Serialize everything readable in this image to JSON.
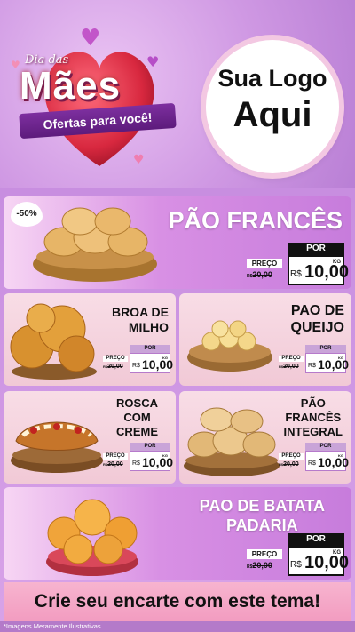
{
  "header": {
    "title_small": "Dia das",
    "title_big": "Mães",
    "ribbon": "Ofertas para você!",
    "logo_line1": "Sua Logo",
    "logo_line2": "Aqui"
  },
  "products": [
    {
      "name": "PÃO FRANCÊS",
      "badge": "-50%",
      "preco_label": "PREÇO",
      "old_prefix": "R$",
      "old_value": "20,00",
      "por_label": "POR",
      "currency": "R$",
      "value": "10,00",
      "unit": "KG"
    },
    {
      "name_line1": "BROA DE",
      "name_line2": "MILHO",
      "preco_label": "PREÇO",
      "old_prefix": "R$",
      "old_value": "20,00",
      "por_label": "POR",
      "currency": "R$",
      "value": "10,00",
      "unit": "KG"
    },
    {
      "name_line1": "PAO DE",
      "name_line2": "QUEIJO",
      "preco_label": "PREÇO",
      "old_prefix": "R$",
      "old_value": "20,00",
      "por_label": "POR",
      "currency": "R$",
      "value": "10,00",
      "unit": "KG"
    },
    {
      "name_line1": "ROSCA",
      "name_line2": "COM",
      "name_line3": "CREME",
      "preco_label": "PREÇO",
      "old_prefix": "R$",
      "old_value": "20,00",
      "por_label": "POR",
      "currency": "R$",
      "value": "10,00",
      "unit": "KG"
    },
    {
      "name_line1": "PÃO",
      "name_line2": "FRANCÊS",
      "name_line3": "INTEGRAL",
      "preco_label": "PREÇO",
      "old_prefix": "R$",
      "old_value": "20,00",
      "por_label": "POR",
      "currency": "R$",
      "value": "10,00",
      "unit": "KG"
    },
    {
      "name_line1": "PAO DE BATATA",
      "name_line2": "PADARIA",
      "preco_label": "PREÇO",
      "old_prefix": "R$",
      "old_value": "20,00",
      "por_label": "POR",
      "currency": "R$",
      "value": "10,00",
      "unit": "KG"
    }
  ],
  "banner": "Crie seu encarte com este tema!",
  "footnote": "*Imagens Meramente Ilustrativas",
  "colors": {
    "accent": "#c77cdc",
    "heart": "#e8344f",
    "ribbon": "#6a2590",
    "banner": "#f4a6c6"
  }
}
